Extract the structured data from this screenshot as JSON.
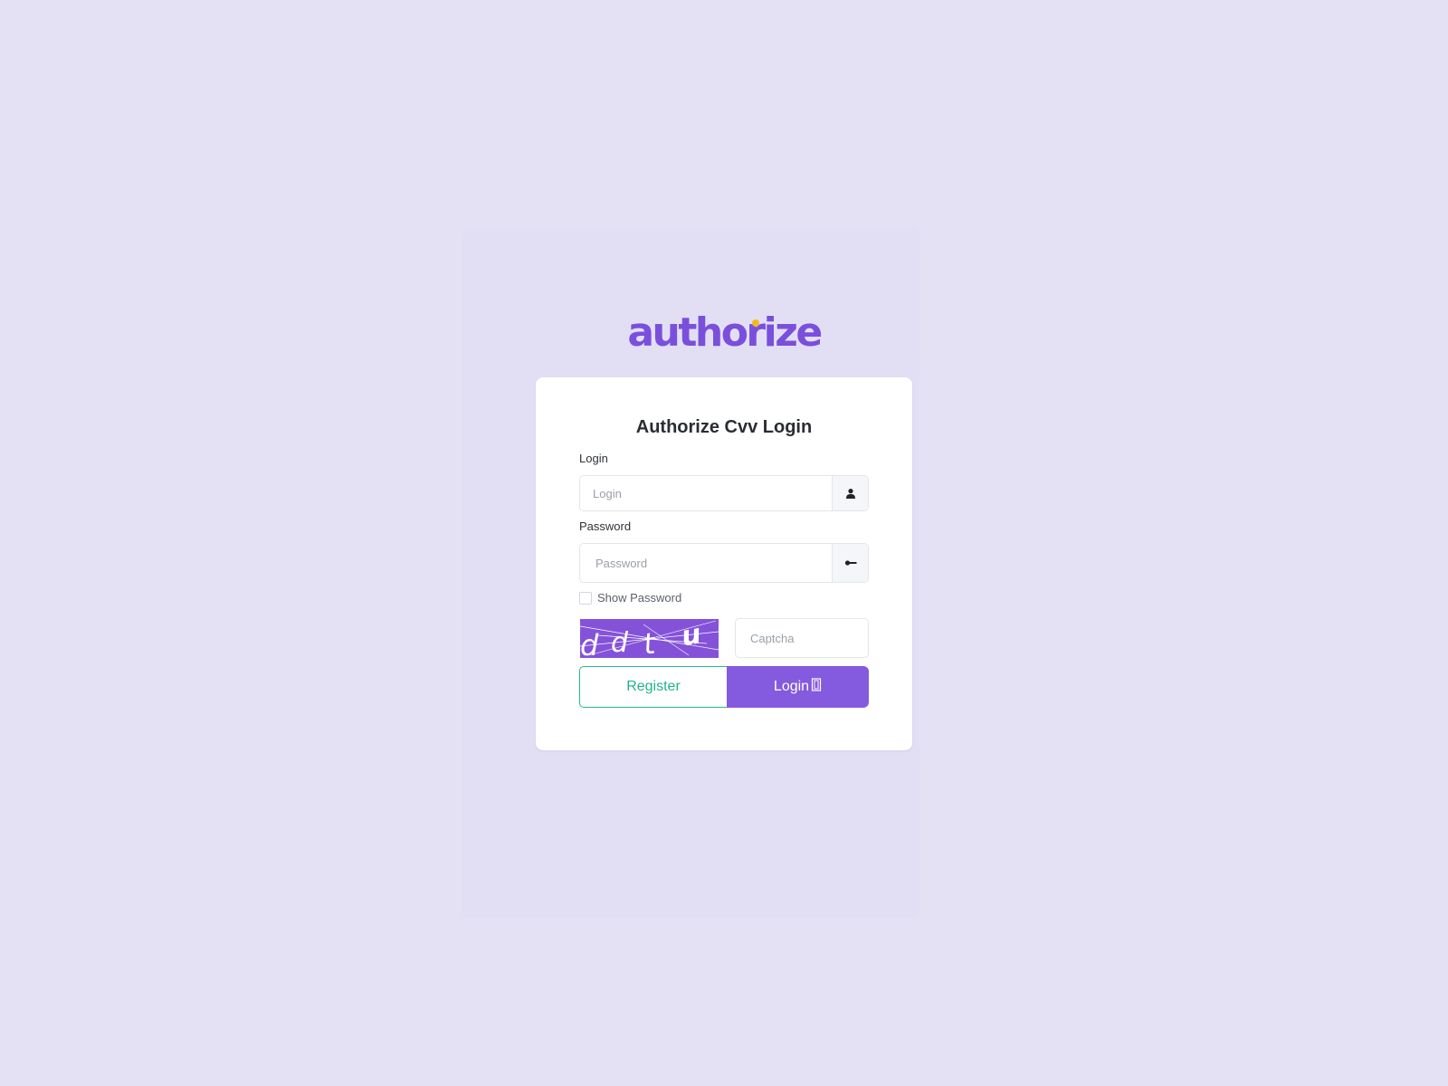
{
  "brand": {
    "logo_text": "authorize",
    "accent_color": "#7a4fdc",
    "logo_dot_color": "#f5b81b"
  },
  "card": {
    "title": "Authorize Cvv Login"
  },
  "login_field": {
    "label": "Login",
    "placeholder": "Login",
    "value": "",
    "icon": "user-icon"
  },
  "password_field": {
    "label": "Password",
    "placeholder": "Password",
    "value": "",
    "icon": "key-icon"
  },
  "show_password": {
    "label": "Show Password",
    "checked": false
  },
  "captcha": {
    "image_text": "ddtu",
    "placeholder": "Captcha",
    "value": ""
  },
  "buttons": {
    "register_label": "Register",
    "login_label": "Login",
    "login_icon": "door-icon",
    "register_color": "#22b389",
    "login_color": "#845ade"
  }
}
